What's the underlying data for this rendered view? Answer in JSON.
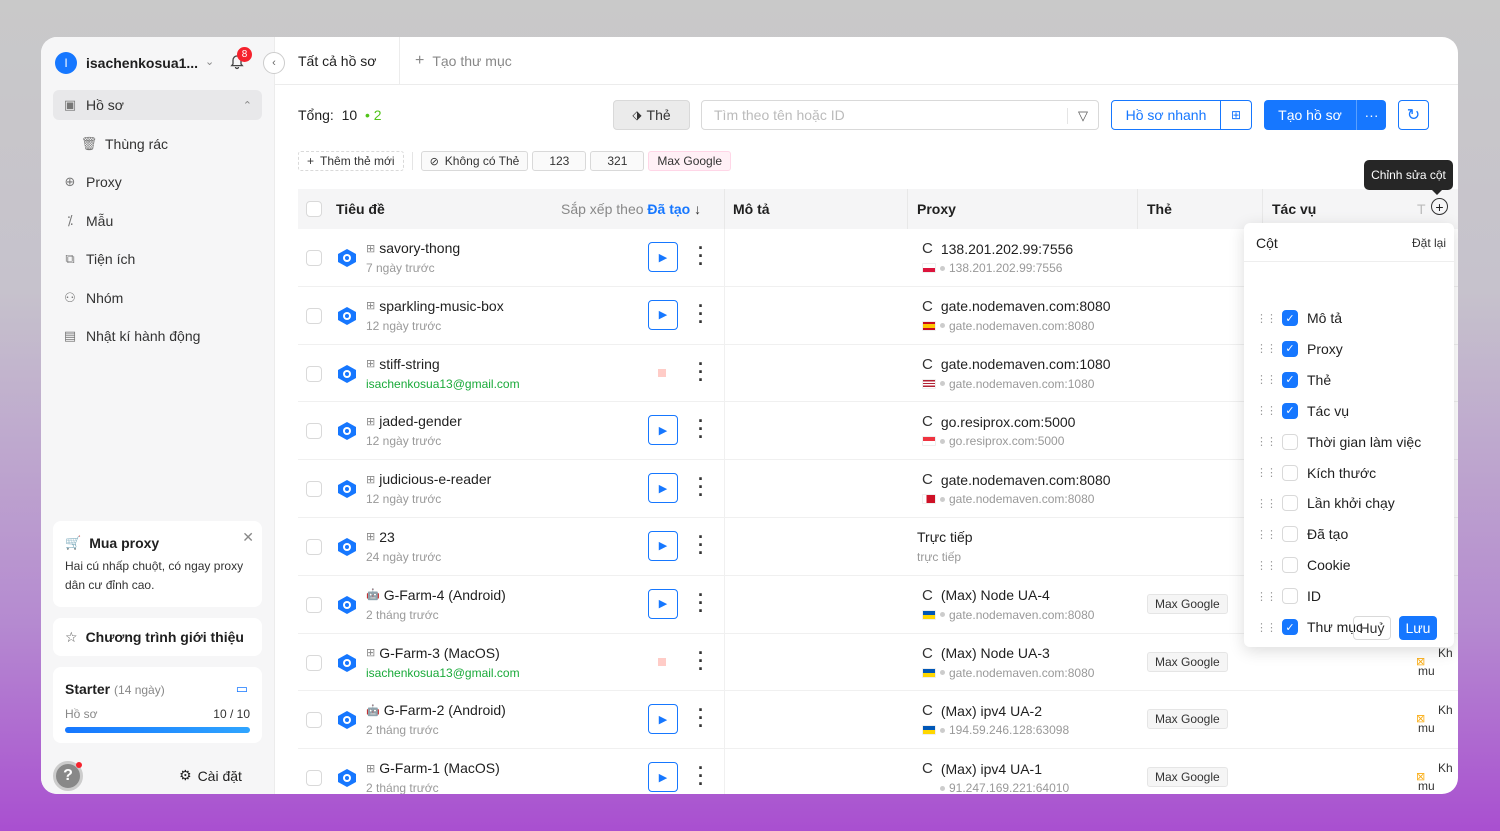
{
  "user": {
    "initial": "I",
    "name": "isachenkosua1...",
    "notifications": "8"
  },
  "nav": [
    {
      "label": "Hồ sơ",
      "icon": "profile-icon"
    },
    {
      "label": "Thùng rác",
      "icon": "trash-icon"
    },
    {
      "label": "Proxy",
      "icon": "globe-icon"
    },
    {
      "label": "Mẫu",
      "icon": "wand-icon"
    },
    {
      "label": "Tiện ích",
      "icon": "puzzle-icon"
    },
    {
      "label": "Nhóm",
      "icon": "group-icon"
    },
    {
      "label": "Nhật kí hành động",
      "icon": "log-icon"
    }
  ],
  "promo": {
    "title": "Mua proxy",
    "desc": "Hai cú nhấp chuột, có ngay proxy dân cư đỉnh cao."
  },
  "referral": {
    "label": "Chương trình giới thiệu"
  },
  "plan": {
    "name": "Starter",
    "days": "(14 ngày)",
    "label": "Hồ sơ",
    "usage": "10 / 10",
    "progress": 1.0
  },
  "settings": {
    "label": "Cài đặt"
  },
  "tabs": {
    "all": "Tất cả hồ sơ",
    "new_folder": "Tạo thư mục"
  },
  "toolbar": {
    "total_label": "Tổng:",
    "total": "10",
    "active": "2",
    "tag_btn": "Thẻ",
    "search_placeholder": "Tìm theo tên hoặc ID",
    "quick_btn": "Hồ sơ nhanh",
    "create_btn": "Tạo hồ sơ",
    "more_btn": "···"
  },
  "tagrow": {
    "add": "Thêm thẻ mới",
    "no_tag": "Không có Thẻ",
    "tags": [
      "123",
      "321",
      "Max Google"
    ]
  },
  "table": {
    "headers": {
      "title": "Tiêu đề",
      "sort_label": "Sắp xếp theo",
      "sort_value": "Đã tạo",
      "desc": "Mô tả",
      "proxy": "Proxy",
      "tag": "Thẻ",
      "action": "Tác vụ",
      "trunc": "T"
    },
    "rows": [
      {
        "name": "savory-thong",
        "sub": "7 ngày trước",
        "sub_green": false,
        "running": false,
        "proxy": "138.201.202.99:7556",
        "proxy_sub": "138.201.202.99:7556",
        "flag": "pl",
        "tag": "",
        "trunc": "",
        "os": "generic"
      },
      {
        "name": "sparkling-music-box",
        "sub": "12 ngày trước",
        "sub_green": false,
        "running": false,
        "proxy": "gate.nodemaven.com:8080",
        "proxy_sub": "gate.nodemaven.com:8080",
        "flag": "es",
        "tag": "",
        "trunc": "",
        "os": "generic"
      },
      {
        "name": "stiff-string",
        "sub": "isachenkosua13@gmail.com",
        "sub_green": true,
        "running": true,
        "proxy": "gate.nodemaven.com:1080",
        "proxy_sub": "gate.nodemaven.com:1080",
        "flag": "us",
        "tag": "",
        "trunc": "",
        "os": "generic"
      },
      {
        "name": "jaded-gender",
        "sub": "12 ngày trước",
        "sub_green": false,
        "running": false,
        "proxy": "go.resiprox.com:5000",
        "proxy_sub": "go.resiprox.com:5000",
        "flag": "sg",
        "tag": "",
        "trunc": "",
        "os": "generic"
      },
      {
        "name": "judicious-e-reader",
        "sub": "12 ngày trước",
        "sub_green": false,
        "running": false,
        "proxy": "gate.nodemaven.com:8080",
        "proxy_sub": "gate.nodemaven.com:8080",
        "flag": "bh",
        "tag": "",
        "trunc": "",
        "os": "generic"
      },
      {
        "name": "23",
        "sub": "24 ngày trước",
        "sub_green": false,
        "running": false,
        "proxy": "",
        "proxy_sub": "",
        "direct": "Trực tiếp",
        "direct_sub": "trực tiếp",
        "flag": "",
        "tag": "",
        "trunc": "",
        "os": "generic"
      },
      {
        "name": "G-Farm-4 (Android)",
        "sub": "2 tháng trước",
        "sub_green": false,
        "running": false,
        "proxy": "(Max) Node UA-4",
        "proxy_sub": "gate.nodemaven.com:8080",
        "flag": "ua",
        "tag": "Max Google",
        "trunc": "",
        "os": "android"
      },
      {
        "name": "G-Farm-3 (MacOS)",
        "sub": "isachenkosua13@gmail.com",
        "sub_green": true,
        "running": true,
        "proxy": "(Max) Node UA-3",
        "proxy_sub": "gate.nodemaven.com:8080",
        "flag": "ua",
        "tag": "Max Google",
        "trunc": "Kh\nmu",
        "os": "generic"
      },
      {
        "name": "G-Farm-2 (Android)",
        "sub": "2 tháng trước",
        "sub_green": false,
        "running": false,
        "proxy": "(Max) ipv4 UA-2",
        "proxy_sub": "194.59.246.128:63098",
        "flag": "ua",
        "tag": "Max Google",
        "trunc": "Kh\nmu",
        "os": "android"
      },
      {
        "name": "G-Farm-1 (MacOS)",
        "sub": "2 tháng trước",
        "sub_green": false,
        "running": false,
        "proxy": "(Max) ipv4 UA-1",
        "proxy_sub": "91.247.169.221:64010",
        "flag": "",
        "tag": "Max Google",
        "trunc": "Kh\nmu",
        "os": "generic"
      }
    ]
  },
  "tooltip": "Chỉnh sửa cột",
  "column_panel": {
    "title": "Cột",
    "reset": "Đặt lại",
    "items": [
      {
        "label": "Mô tả",
        "checked": true
      },
      {
        "label": "Proxy",
        "checked": true
      },
      {
        "label": "Thẻ",
        "checked": true
      },
      {
        "label": "Tác vụ",
        "checked": true
      },
      {
        "label": "Thời gian làm việc",
        "checked": false
      },
      {
        "label": "Kích thước",
        "checked": false
      },
      {
        "label": "Lần khởi chạy",
        "checked": false
      },
      {
        "label": "Đã tạo",
        "checked": false
      },
      {
        "label": "Cookie",
        "checked": false
      },
      {
        "label": "ID",
        "checked": false
      },
      {
        "label": "Thư mục",
        "checked": true
      }
    ],
    "cancel": "Huỷ",
    "save": "Lưu"
  },
  "colors": {
    "accent": "#1677ff",
    "active_green": "#52c41a",
    "email_green": "#1aaa3a"
  }
}
